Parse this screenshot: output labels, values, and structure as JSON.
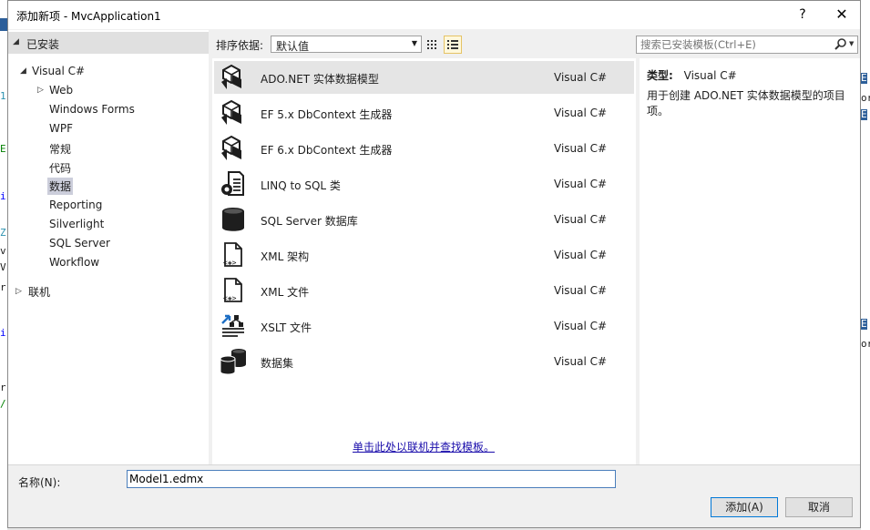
{
  "window": {
    "title": "添加新项 - MvcApplication1",
    "help_label": "?",
    "close_label": "✕"
  },
  "left_tree": {
    "installed_label": "已安装",
    "visual_csharp_label": "Visual C#",
    "children": [
      "Web",
      "Windows Forms",
      "WPF",
      "常规",
      "代码",
      "数据",
      "Reporting",
      "Silverlight",
      "SQL Server",
      "Workflow"
    ],
    "selected_child": "数据",
    "online_label": "联机"
  },
  "toolbar": {
    "sort_label": "排序依据:",
    "sort_value": "默认值",
    "search_placeholder": "搜索已安装模板(Ctrl+E)"
  },
  "templates": [
    {
      "name": "ADO.NET 实体数据模型",
      "lang": "Visual C#",
      "icon": "ado-net-entity-model-icon",
      "selected": true
    },
    {
      "name": "EF 5.x DbContext 生成器",
      "lang": "Visual C#",
      "icon": "ef5-dbcontext-generator-icon"
    },
    {
      "name": "EF 6.x DbContext 生成器",
      "lang": "Visual C#",
      "icon": "ef6-dbcontext-generator-icon"
    },
    {
      "name": "LINQ to SQL 类",
      "lang": "Visual C#",
      "icon": "linq-to-sql-icon"
    },
    {
      "name": "SQL Server 数据库",
      "lang": "Visual C#",
      "icon": "database-icon"
    },
    {
      "name": "XML 架构",
      "lang": "Visual C#",
      "icon": "xml-schema-icon"
    },
    {
      "name": "XML 文件",
      "lang": "Visual C#",
      "icon": "xml-file-icon"
    },
    {
      "name": "XSLT 文件",
      "lang": "Visual C#",
      "icon": "xslt-file-icon"
    },
    {
      "name": "数据集",
      "lang": "Visual C#",
      "icon": "dataset-icon"
    }
  ],
  "online_link": "单击此处以联机并查找模板。",
  "details": {
    "type_label": "类型:",
    "type_value": "Visual C#",
    "description": "用于创建 ADO.NET 实体数据模型的项目项。"
  },
  "name_field": {
    "label": "名称(N):",
    "value": "Model1.edmx"
  },
  "buttons": {
    "add": "添加(A)",
    "cancel": "取消"
  },
  "colors": {
    "accent": "#0078d7",
    "link": "#1a0dab",
    "selection": "#e5e5e5"
  }
}
